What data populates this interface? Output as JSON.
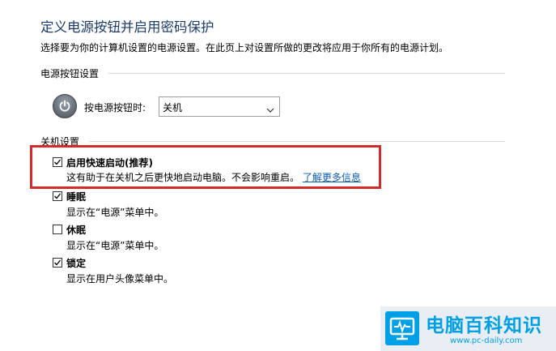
{
  "page": {
    "title": "定义电源按钮并启用密码保护",
    "description": "选择要为你的计算机设置的电源设置。在此页上对设置所做的更改将应用于你所有的电源计划。"
  },
  "power_section": {
    "header": "电源按钮设置",
    "label": "按电源按钮时:",
    "selected": "关机"
  },
  "shutdown_section": {
    "header": "关机设置",
    "options": [
      {
        "label": "启用快速启动(推荐)",
        "desc": "这有助于在关机之后更快地启动电脑。不会影响重启。",
        "link": "了解更多信息",
        "checked": true
      },
      {
        "label": "睡眠",
        "desc": "显示在“电源”菜单中。",
        "checked": true
      },
      {
        "label": "休眠",
        "desc": "显示在“电源”菜单中。",
        "checked": false
      },
      {
        "label": "锁定",
        "desc": "显示在用户头像菜单中。",
        "checked": true
      }
    ]
  },
  "watermark": {
    "name": "电脑百科知识",
    "url": "www.pc-daily.com"
  },
  "colors": {
    "title": "#1a3b6b",
    "link": "#0b5fb5",
    "highlight": "#d42a2a",
    "watermark": "#00a0e9"
  }
}
